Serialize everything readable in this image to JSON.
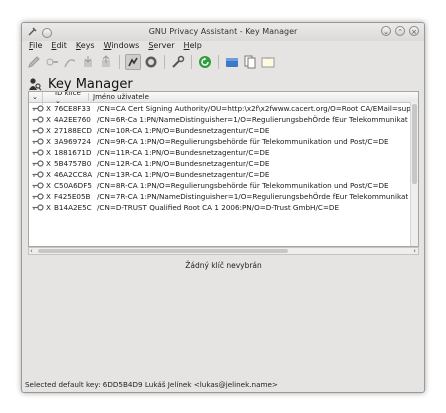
{
  "window": {
    "title": "GNU Privacy Assistant - Key Manager"
  },
  "menu": [
    "File",
    "Edit",
    "Keys",
    "Windows",
    "Server",
    "Help"
  ],
  "heading": "Key Manager",
  "columns": {
    "id": "ID klíče",
    "name": "Jméno uživatele"
  },
  "keys": [
    {
      "trust": "X",
      "id": "76CE8F33",
      "name": "/CN=CA Cert Signing Authority/OU=http:\\x2f\\x2fwww.cacert.org/O=Root CA/EMail=sup"
    },
    {
      "trust": "X",
      "id": "4A2EE760",
      "name": "/CN=6R-Ca 1:PN/NameDistinguisher=1/O=RegulierungsbehÖrde fEur Telekommunikat"
    },
    {
      "trust": "X",
      "id": "27188ECD",
      "name": "/CN=10R-CA 1:PN/O=Bundesnetzagentur/C=DE"
    },
    {
      "trust": "X",
      "id": "3A969724",
      "name": "/CN=9R-CA 1:PN/O=Regulierungsbehörde für Telekommunikation und Post/C=DE"
    },
    {
      "trust": "X",
      "id": "1881671D",
      "name": "/CN=11R-CA 1:PN/O=Bundesnetzagentur/C=DE"
    },
    {
      "trust": "X",
      "id": "5B4757B0",
      "name": "/CN=12R-CA 1:PN/O=Bundesnetzagentur/C=DE"
    },
    {
      "trust": "X",
      "id": "46A2CC8A",
      "name": "/CN=13R-CA 1:PN/O=Bundesnetzagentur/C=DE"
    },
    {
      "trust": "X",
      "id": "C50A6DF5",
      "name": "/CN=8R-CA 1:PN/O=Regulierungsbehörde für Telekommunikation und Post/C=DE"
    },
    {
      "trust": "X",
      "id": "F425E05B",
      "name": "/CN=7R-CA 1:PN/NameDistinguisher=1/O=RegulierungsbehÖrde fEur Telekommunikat"
    },
    {
      "trust": "X",
      "id": "B14A2E5C",
      "name": "/CN=D-TRUST Qualified Root CA 1 2006:PN/O=D-Trust GmbH/C=DE"
    }
  ],
  "details": {
    "no_selection": "Žádný klíč nevybrán"
  },
  "status": {
    "text": "Selected default key: 6DD5B4D9 Lukáš Jelínek <lukas@jelinek.name>"
  },
  "icons": {
    "toolbar": [
      "edit-icon",
      "delete-icon",
      "sign-icon",
      "import-icon",
      "export-icon",
      "brief-view-icon",
      "detail-view-icon",
      "preferences-icon",
      "refresh-icon",
      "keyring-icon",
      "files-icon",
      "clipboard-icon"
    ],
    "key_row": "key-icon"
  },
  "colors": {
    "window_bg": "#e6e4e2",
    "list_bg": "#ffffff",
    "refresh_green": "#2e9e3a",
    "keyring_blue": "#3c78c8"
  }
}
